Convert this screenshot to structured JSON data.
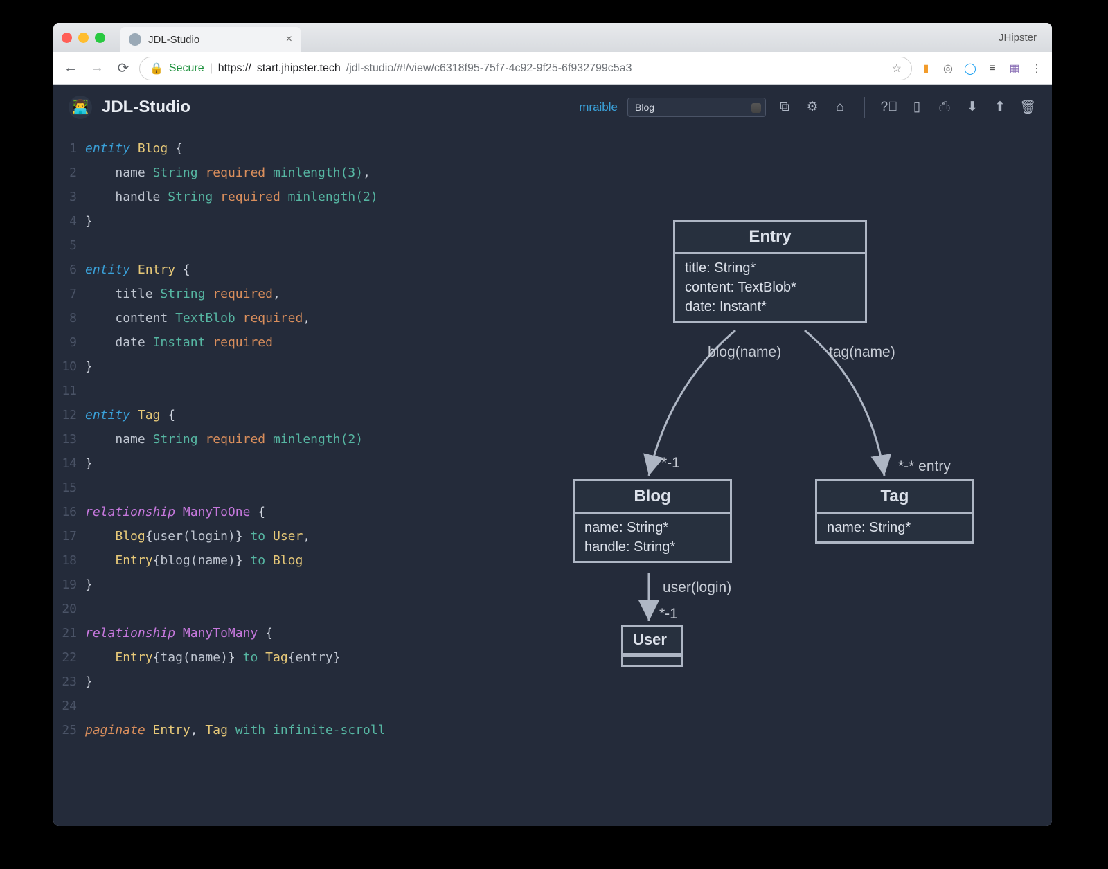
{
  "window": {
    "tab_title": "JDL-Studio",
    "profile_name": "JHipster"
  },
  "browser": {
    "secure_label": "Secure",
    "url_scheme": "https://",
    "url_host": "start.jhipster.tech",
    "url_path": "/jdl-studio/#!/view/c6318f95-75f7-4c92-9f25-6f932799c5a3"
  },
  "header": {
    "app_title": "JDL-Studio",
    "username": "mraible",
    "selected_entity": "Blog"
  },
  "code_lines": [
    {
      "n": "1",
      "html": "<span class='kw-ent'>entity</span> <span class='name'>Blog</span> {"
    },
    {
      "n": "2",
      "html": "    <span class='c-plain'>name</span> <span class='type'>String</span> <span class='req'>required</span> <span class='fn'>minlength(3)</span>,"
    },
    {
      "n": "3",
      "html": "    <span class='c-plain'>handle</span> <span class='type'>String</span> <span class='req'>required</span> <span class='fn'>minlength(2)</span>"
    },
    {
      "n": "4",
      "html": "}"
    },
    {
      "n": "5",
      "html": ""
    },
    {
      "n": "6",
      "html": "<span class='kw-ent'>entity</span> <span class='name'>Entry</span> {"
    },
    {
      "n": "7",
      "html": "    <span class='c-plain'>title</span> <span class='type'>String</span> <span class='req'>required</span>,"
    },
    {
      "n": "8",
      "html": "    <span class='c-plain'>content</span> <span class='type'>TextBlob</span> <span class='req'>required</span>,"
    },
    {
      "n": "9",
      "html": "    <span class='c-plain'>date</span> <span class='type'>Instant</span> <span class='req'>required</span>"
    },
    {
      "n": "10",
      "html": "}"
    },
    {
      "n": "11",
      "html": ""
    },
    {
      "n": "12",
      "html": "<span class='kw-ent'>entity</span> <span class='name'>Tag</span> {"
    },
    {
      "n": "13",
      "html": "    <span class='c-plain'>name</span> <span class='type'>String</span> <span class='req'>required</span> <span class='fn'>minlength(2)</span>"
    },
    {
      "n": "14",
      "html": "}"
    },
    {
      "n": "15",
      "html": ""
    },
    {
      "n": "16",
      "html": "<span class='kw-rel'>relationship</span> <span class='relt'>ManyToOne</span> {"
    },
    {
      "n": "17",
      "html": "    <span class='name'>Blog</span>{<span class='c-plain'>user(login)</span>} <span class='to'>to</span> <span class='name'>User</span>,"
    },
    {
      "n": "18",
      "html": "    <span class='name'>Entry</span>{<span class='c-plain'>blog(name)</span>} <span class='to'>to</span> <span class='name'>Blog</span>"
    },
    {
      "n": "19",
      "html": "}"
    },
    {
      "n": "20",
      "html": ""
    },
    {
      "n": "21",
      "html": "<span class='kw-rel'>relationship</span> <span class='relt'>ManyToMany</span> {"
    },
    {
      "n": "22",
      "html": "    <span class='name'>Entry</span>{<span class='c-plain'>tag(name)</span>} <span class='to'>to</span> <span class='name'>Tag</span>{<span class='c-plain'>entry</span>}"
    },
    {
      "n": "23",
      "html": "}"
    },
    {
      "n": "24",
      "html": ""
    },
    {
      "n": "25",
      "html": "<span class='kw-pag'>paginate</span> <span class='name'>Entry</span>, <span class='name'>Tag</span> <span class='to'>with</span> <span class='type'>infinite-scroll</span>"
    }
  ],
  "diagram": {
    "entry_title": "Entry",
    "entry_body": "title: String*\ncontent: TextBlob*\ndate: Instant*",
    "blog_title": "Blog",
    "blog_body": "name: String*\nhandle: String*",
    "tag_title": "Tag",
    "tag_body": "name: String*",
    "user_title": "User",
    "lbl_blogname": "blog(name)",
    "lbl_tagname": "tag(name)",
    "lbl_star1_left": "*-1",
    "lbl_starstar_entry": "*-* entry",
    "lbl_userlogin": "user(login)",
    "lbl_star1_user": "*-1"
  }
}
